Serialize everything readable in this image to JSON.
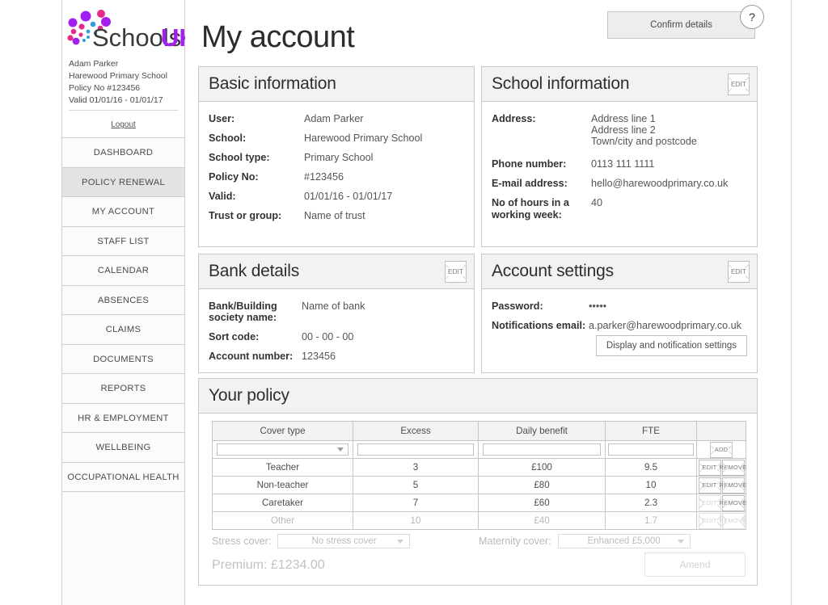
{
  "brand": {
    "name_dark": "Schools",
    "name_accent": "UK",
    "accent_color": "#a21ff0",
    "dot_colors": [
      "#a21ff0",
      "#e62a8b",
      "#2f9fd6",
      "#7b1fa2"
    ]
  },
  "sidebar": {
    "user": {
      "name": "Adam Parker",
      "school": "Harewood Primary School",
      "policy_no": "Policy No #123456",
      "valid": "Valid 01/01/16 - 01/01/17"
    },
    "logout_label": "Logout",
    "items": [
      {
        "label": "DASHBOARD",
        "active": false
      },
      {
        "label": "POLICY RENEWAL",
        "active": true
      },
      {
        "label": "MY ACCOUNT",
        "active": false
      },
      {
        "label": "STAFF LIST",
        "active": false
      },
      {
        "label": "CALENDAR",
        "active": false
      },
      {
        "label": "ABSENCES",
        "active": false
      },
      {
        "label": "CLAIMS",
        "active": false
      },
      {
        "label": "DOCUMENTS",
        "active": false
      },
      {
        "label": "REPORTS",
        "active": false
      },
      {
        "label": "HR & EMPLOYMENT",
        "active": false
      },
      {
        "label": "WELLBEING",
        "active": false
      },
      {
        "label": "OCCUPATIONAL HEALTH",
        "active": false
      }
    ]
  },
  "header": {
    "title": "My account",
    "confirm_label": "Confirm details",
    "help_label": "?"
  },
  "basic_information": {
    "title": "Basic information",
    "rows": [
      {
        "label": "User:",
        "value": "Adam Parker"
      },
      {
        "label": "School:",
        "value": "Harewood Primary School"
      },
      {
        "label": "School type:",
        "value": "Primary School"
      },
      {
        "label": "Policy No:",
        "value": "#123456"
      },
      {
        "label": "Valid:",
        "value": "01/01/16 - 01/01/17"
      },
      {
        "label": "Trust or group:",
        "value": "Name of trust"
      }
    ]
  },
  "school_information": {
    "title": "School information",
    "edit_label": "EDIT",
    "address_label": "Address:",
    "address_lines": [
      "Address line 1",
      "Address line 2",
      "Town/city and postcode"
    ],
    "rows": [
      {
        "label": "Phone number:",
        "value": "0113 111 1111"
      },
      {
        "label": "E-mail address:",
        "value": "hello@harewoodprimary.co.uk"
      },
      {
        "label": "No of hours in a working week:",
        "value": "40"
      }
    ]
  },
  "bank_details": {
    "title": "Bank details",
    "edit_label": "EDIT",
    "rows": [
      {
        "label": "Bank/Building society name:",
        "value": "Name of bank"
      },
      {
        "label": "Sort code:",
        "value": "00 - 00 - 00"
      },
      {
        "label": "Account number:",
        "value": "123456"
      }
    ]
  },
  "account_settings": {
    "title": "Account settings",
    "edit_label": "EDIT",
    "rows": [
      {
        "label": "Password:",
        "value": "•••••"
      },
      {
        "label": "Notifications email:",
        "value": "a.parker@harewoodprimary.co.uk"
      }
    ],
    "settings_button_label": "Display and notification settings"
  },
  "your_policy": {
    "title": "Your policy",
    "table": {
      "columns": [
        "Cover type",
        "Excess",
        "Daily benefit",
        "FTE",
        ""
      ],
      "new_row": {
        "cover_type_value": "",
        "excess_value": "",
        "daily_benefit_value": "",
        "fte_value": "",
        "add_label": "ADD"
      },
      "rows": [
        {
          "cover_type": "Teacher",
          "excess": "3",
          "daily_benefit": "£100",
          "fte": "9.5",
          "edit_label": "EDIT",
          "remove_label": "REMOVE",
          "faded": false,
          "actions_disabled": false
        },
        {
          "cover_type": "Non-teacher",
          "excess": "5",
          "daily_benefit": "£80",
          "fte": "10",
          "edit_label": "EDIT",
          "remove_label": "REMOVE",
          "faded": false,
          "actions_disabled": false
        },
        {
          "cover_type": "Caretaker",
          "excess": "7",
          "daily_benefit": "£60",
          "fte": "2.3",
          "edit_label": "EDIT",
          "remove_label": "REMOVE",
          "faded": false,
          "actions_disabled": true
        },
        {
          "cover_type": "Other",
          "excess": "10",
          "daily_benefit": "£40",
          "fte": "1.7",
          "edit_label": "EDIT",
          "remove_label": "REMOVE",
          "faded": true,
          "actions_disabled": true
        }
      ]
    },
    "stress_cover": {
      "label": "Stress cover:",
      "selected": "No stress cover"
    },
    "maternity_cover": {
      "label": "Maternity cover:",
      "selected": "Enhanced £5,000"
    },
    "premium_label": "Premium:",
    "premium_value": "£1234.00",
    "amend_label": "Amend"
  }
}
